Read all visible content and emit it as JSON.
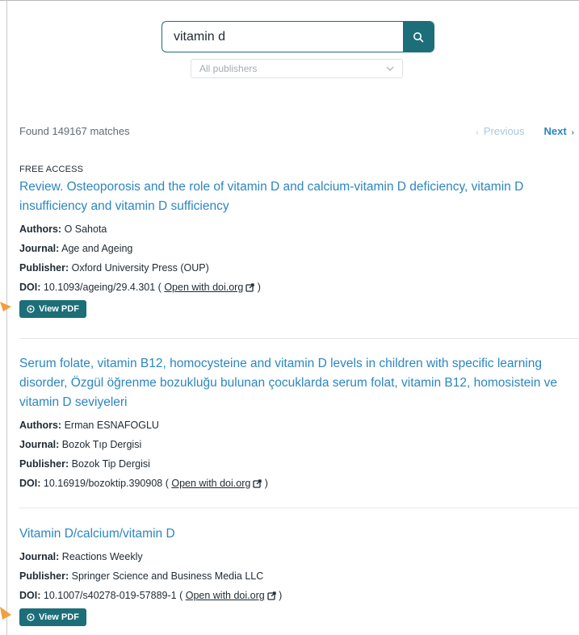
{
  "search": {
    "query": "vitamin d",
    "publisher_filter": "All publishers"
  },
  "summary": {
    "matches_text": "Found 149167 matches",
    "prev_label": "Previous",
    "next_label": "Next"
  },
  "results": [
    {
      "access": "FREE ACCESS",
      "title": "Review. Osteoporosis and the role of vitamin D and calcium-vitamin D deficiency, vitamin D insufficiency and vitamin D sufficiency",
      "authors_label": "Authors:",
      "authors": "O Sahota",
      "journal_label": "Journal:",
      "journal": "Age and Ageing",
      "publisher_label": "Publisher:",
      "publisher": "Oxford University Press (OUP)",
      "doi_label": "DOI:",
      "doi": "10.1093/ageing/29.4.301",
      "doi_link": "Open with doi.org",
      "pdf_label": "View PDF"
    },
    {
      "title": "Serum folate, vitamin B12, homocysteine and vitamin D levels in children with specific learning disorder, Özgül öğrenme bozukluğu bulunan çocuklarda serum folat, vitamin B12, homosistein ve vitamin D seviyeleri",
      "authors_label": "Authors:",
      "authors": "Erman ESNAFOGLU",
      "journal_label": "Journal:",
      "journal": "Bozok Tıp Dergisi",
      "publisher_label": "Publisher:",
      "publisher": "Bozok Tip Dergisi",
      "doi_label": "DOI:",
      "doi": "10.16919/bozoktip.390908",
      "doi_link": "Open with doi.org"
    },
    {
      "title": "Vitamin D/calcium/vitamin D",
      "journal_label": "Journal:",
      "journal": "Reactions Weekly",
      "publisher_label": "Publisher:",
      "publisher": "Springer Science and Business Media LLC",
      "doi_label": "DOI:",
      "doi": "10.1007/s40278-019-57889-1",
      "doi_link": "Open with doi.org",
      "pdf_label": "View PDF"
    }
  ],
  "colors": {
    "accent": "#1c6e78",
    "link": "#2c86c0",
    "annotation_arrow": "#f0a040"
  },
  "icons": [
    "search-icon",
    "chevron-down-icon",
    "external-link-icon",
    "pdf-icon",
    "arrow-annotation"
  ]
}
